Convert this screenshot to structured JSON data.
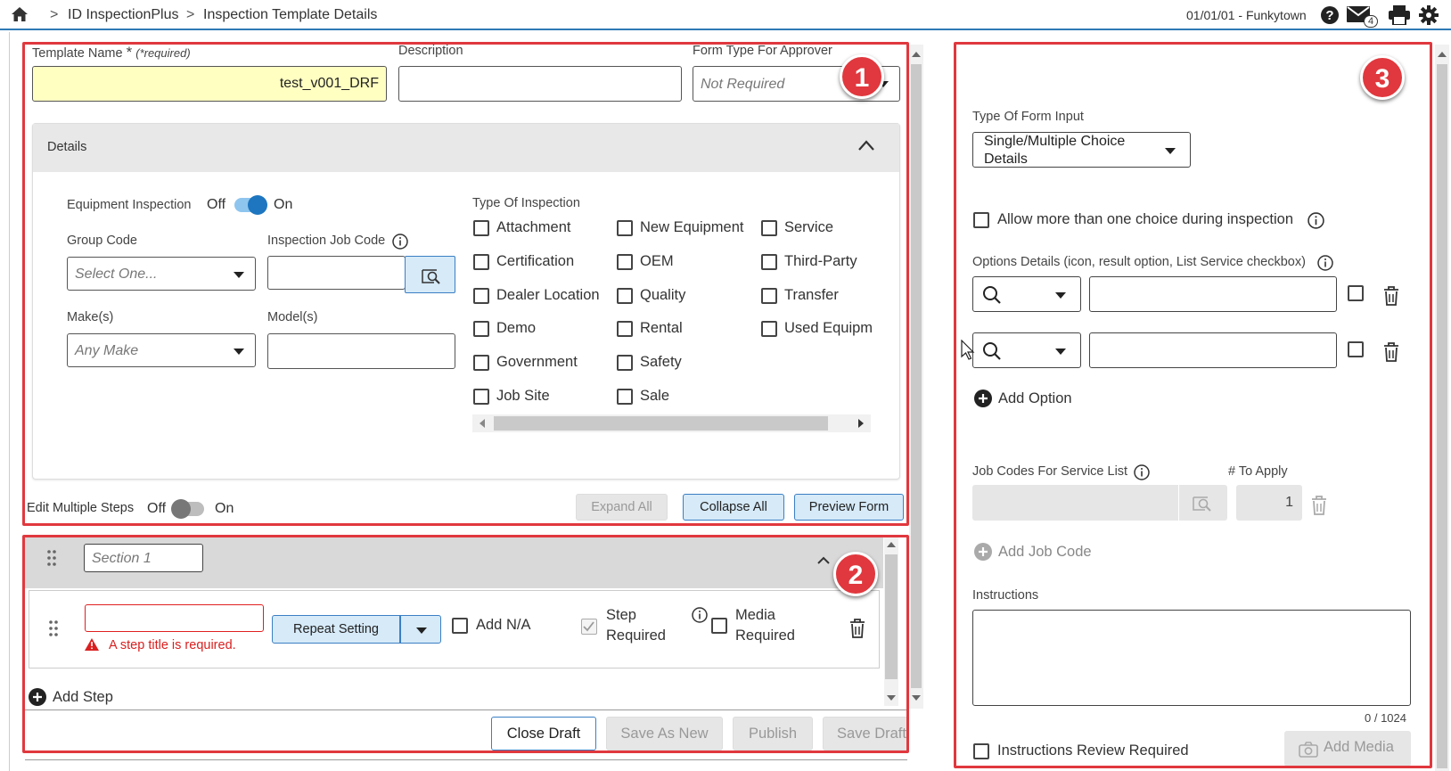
{
  "topbar": {
    "home_icon": "home-icon",
    "crumb_sep": ">",
    "crumbs": [
      "ID InspectionPlus",
      "Inspection Template Details"
    ],
    "date_location": "01/01/01 - Funkytown",
    "mail_count": "4",
    "accent_color": "#2d7ab5"
  },
  "annotations": {
    "badge1": "1",
    "badge2": "2",
    "badge3": "3",
    "color": "#e0383e"
  },
  "header_fields": {
    "template_name_label": "Template Name",
    "required_star": "*",
    "required_note": "(*required)",
    "template_name_value": "test_v001_DRF",
    "description_label": "Description",
    "description_value": "",
    "form_type_label": "Form Type For Approver",
    "form_type_value": "Not Required"
  },
  "details": {
    "title": "Details",
    "equipment_inspection_label": "Equipment Inspection",
    "toggle_off": "Off",
    "toggle_on": "On",
    "group_code_label": "Group Code",
    "group_code_placeholder": "Select One...",
    "job_code_label": "Inspection Job Code",
    "makes_label": "Make(s)",
    "makes_placeholder": "Any Make",
    "models_label": "Model(s)",
    "type_of_inspection_label": "Type Of Inspection",
    "types": [
      [
        "Attachment",
        "Certification",
        "Dealer Location",
        "Demo",
        "Government",
        "Job Site"
      ],
      [
        "New Equipment",
        "OEM",
        "Quality",
        "Rental",
        "Safety",
        "Sale"
      ],
      [
        "Service",
        "Third-Party",
        "Transfer",
        "Used Equipm"
      ]
    ]
  },
  "steps_bar": {
    "edit_multiple_label": "Edit Multiple Steps",
    "off": "Off",
    "on": "On",
    "expand_all": "Expand All",
    "collapse_all": "Collapse All",
    "preview_form": "Preview Form"
  },
  "section": {
    "name_placeholder": "Section 1",
    "step_error": "A step title is required.",
    "repeat_setting": "Repeat Setting",
    "add_na": "Add N/A",
    "step_required": [
      "Step",
      "Required"
    ],
    "media_required": [
      "Media",
      "Required"
    ],
    "add_step": "Add Step"
  },
  "footer": {
    "close_draft": "Close Draft",
    "save_as_new": "Save As New",
    "publish": "Publish",
    "save_draft": "Save Draft"
  },
  "right_panel": {
    "type_of_form_input_label": "Type Of Form Input",
    "type_of_form_input_value_line1": "Single/Multiple Choice",
    "type_of_form_input_value_line2": "Details",
    "allow_multiple_label": "Allow more than one choice during inspection",
    "options_details_label": "Options Details (icon, result option, List Service checkbox)",
    "add_option": "Add Option",
    "job_codes_label": "Job Codes For Service List",
    "to_apply_label": "# To Apply",
    "to_apply_value": "1",
    "add_job_code": "Add Job Code",
    "instructions_label": "Instructions",
    "char_count": "0 / 1024",
    "instructions_review_label": "Instructions Review Required",
    "add_media": "Add Media"
  }
}
